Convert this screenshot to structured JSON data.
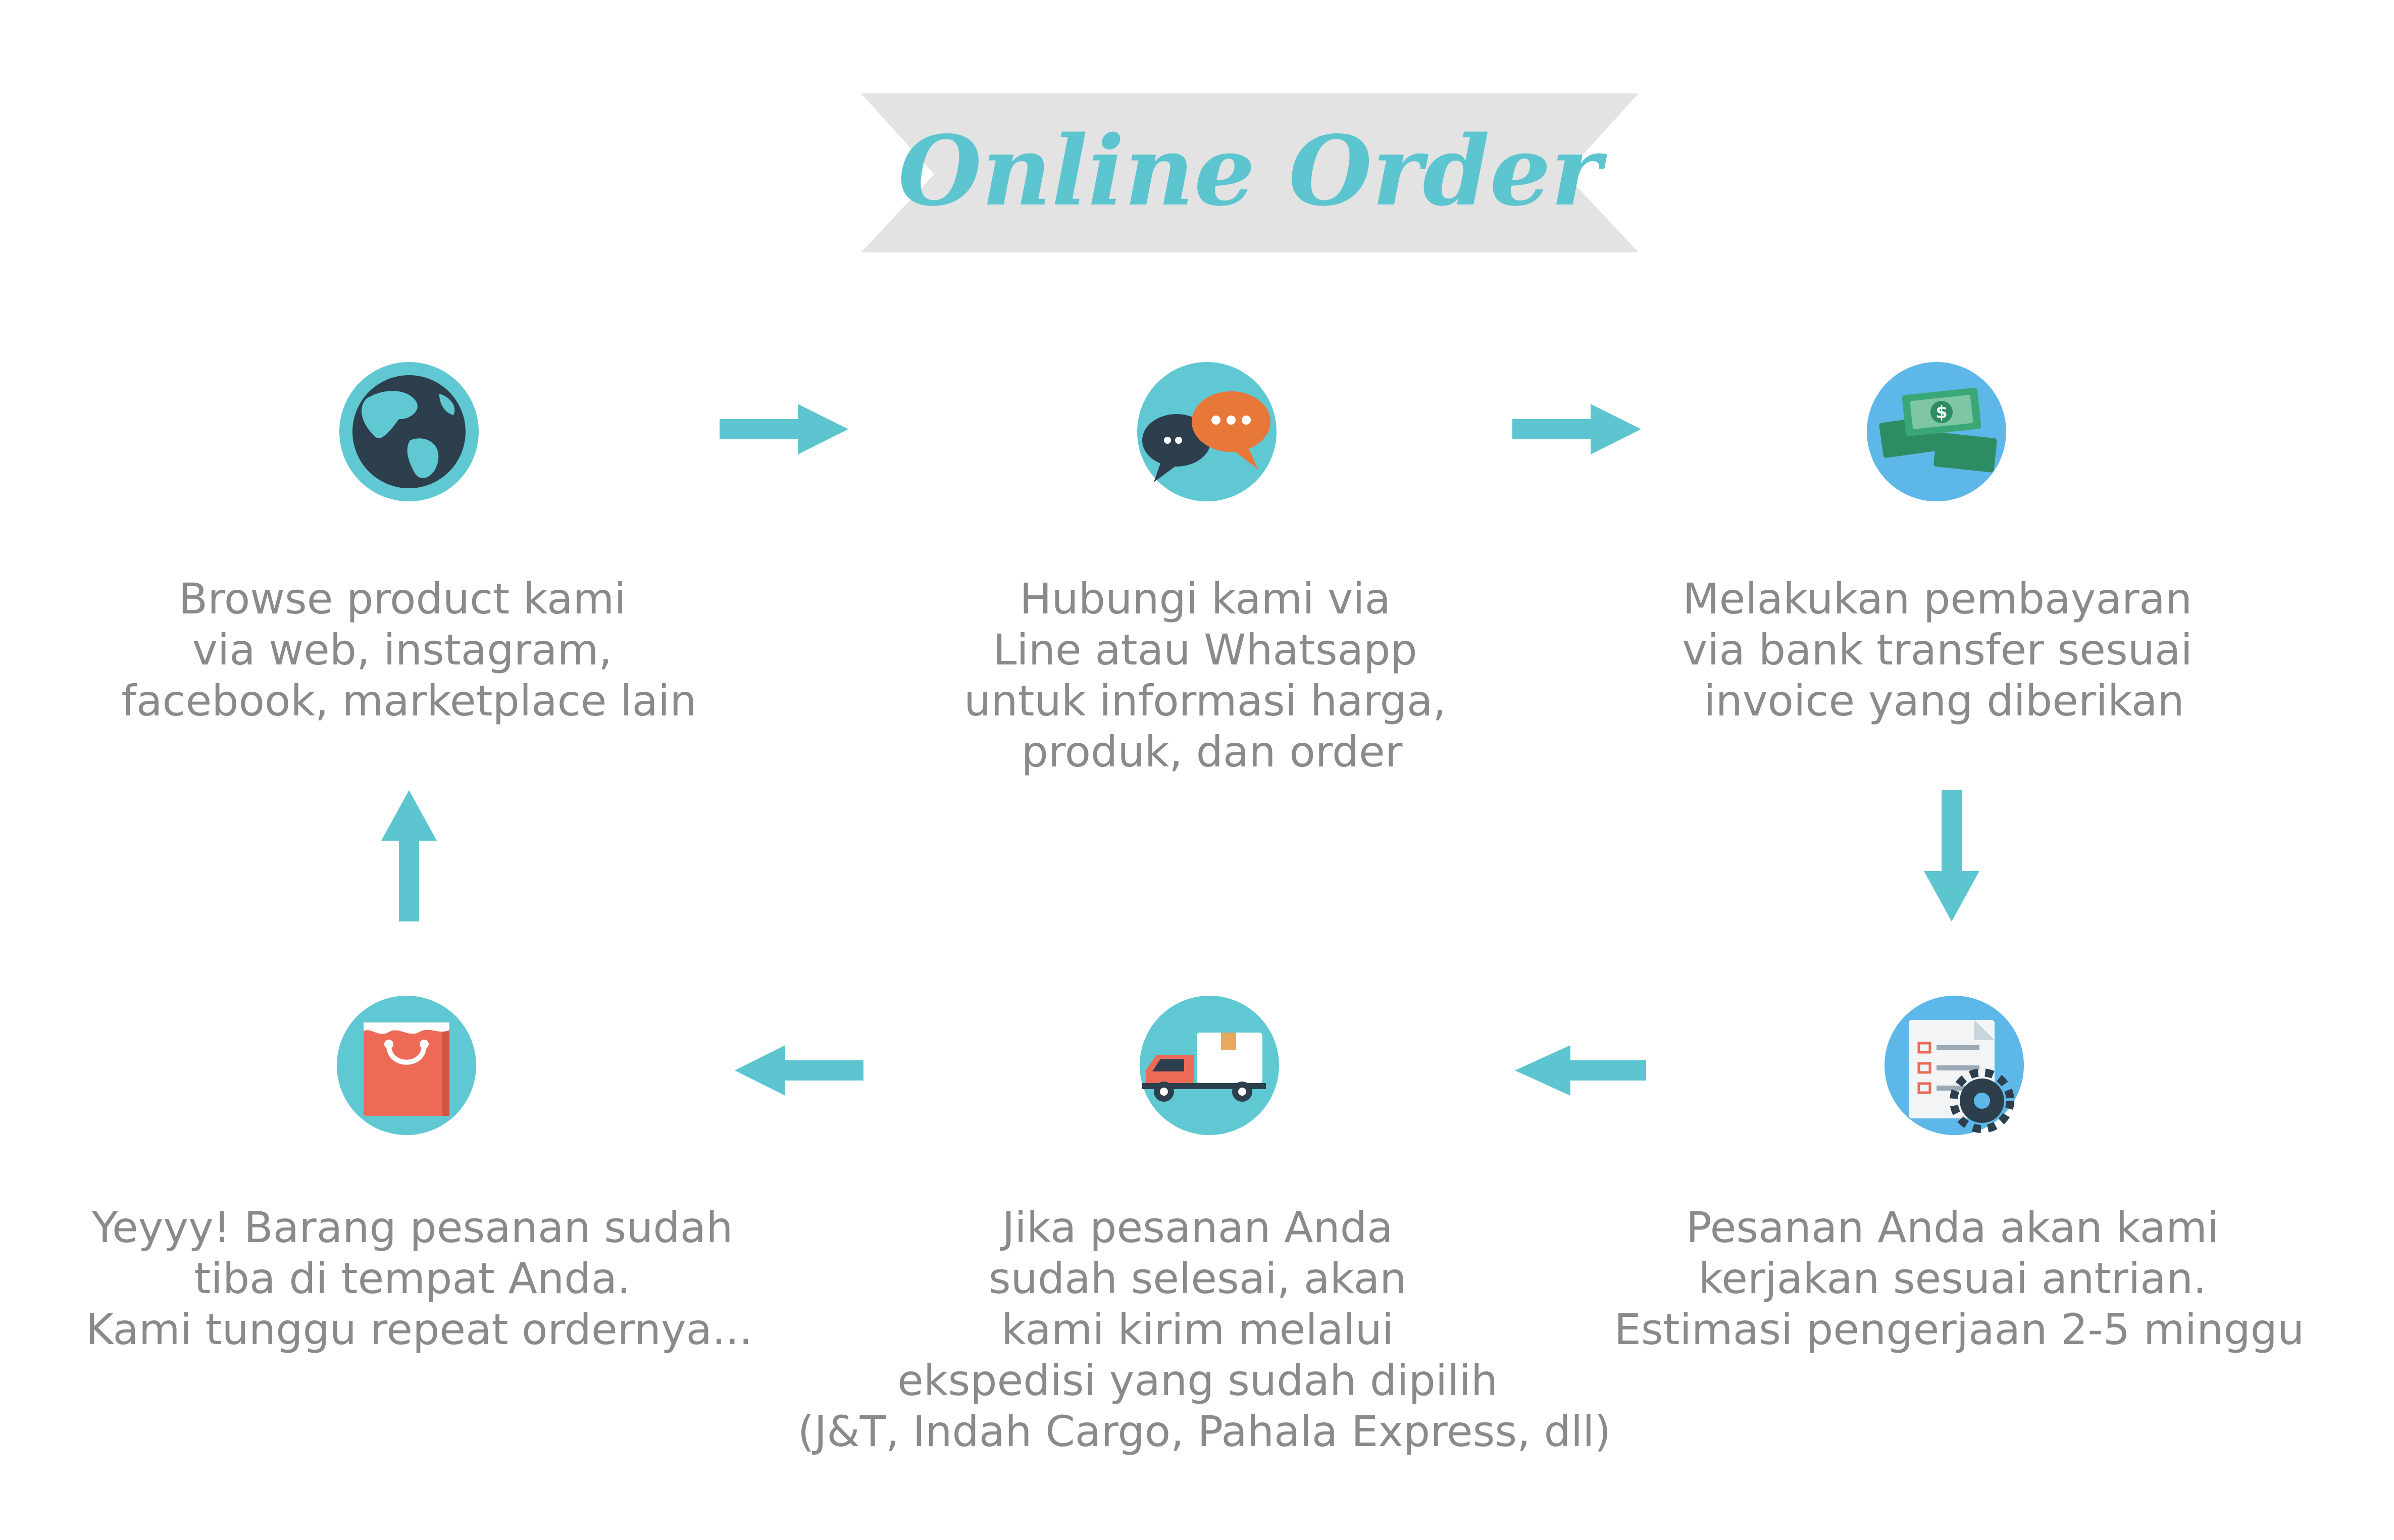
{
  "title": "Online Order",
  "colors": {
    "accent": "#5cc5cf",
    "banner": "#e3e3e3",
    "text": "#8a8a8a",
    "circle_light": "#60c8d2",
    "circle_blue": "#5db7e8",
    "dark": "#2d3f4c",
    "orange": "#e8773a",
    "red": "#ec6a56",
    "cash": "#2e8c62"
  },
  "steps": [
    {
      "icon": "globe-icon",
      "lines": [
        "Browse product kami",
        "via web, instagram,",
        "facebook, marketplace lain"
      ]
    },
    {
      "icon": "chat-bubbles-icon",
      "lines": [
        "Hubungi kami via",
        "Line atau Whatsapp",
        "untuk informasi harga,",
        "produk, dan order"
      ]
    },
    {
      "icon": "money-icon",
      "lines": [
        "Melakukan pembayaran",
        "via bank transfer sesuai",
        "invoice yang diberikan"
      ]
    },
    {
      "icon": "checklist-gear-icon",
      "lines": [
        "Pesanan Anda akan kami",
        "kerjakan sesuai antrian.",
        "Estimasi pengerjaan 2-5 minggu"
      ]
    },
    {
      "icon": "delivery-truck-icon",
      "lines": [
        "Jika pesanan Anda",
        "sudah selesai, akan",
        "kami kirim melalui",
        "ekspedisi yang sudah dipilih",
        "(J&T, Indah Cargo, Pahala Express, dll)"
      ]
    },
    {
      "icon": "shopping-bag-icon",
      "lines": [
        "Yeyyy! Barang pesanan sudah",
        "tiba di tempat Anda.",
        "Kami tunggu repeat ordernya..."
      ]
    }
  ]
}
